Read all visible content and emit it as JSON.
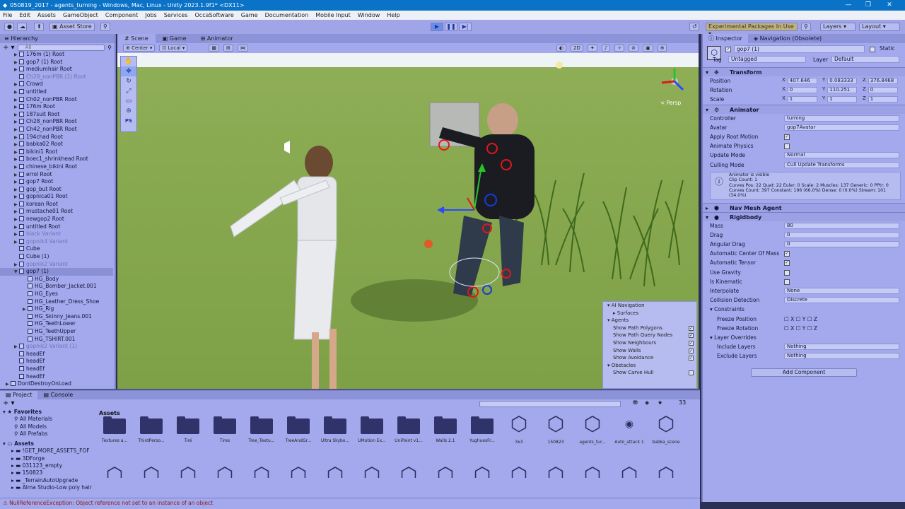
{
  "window": {
    "title": "050819_2017 - agents_turning - Windows, Mac, Linux - Unity 2023.1.9f1* <DX11>",
    "controls": [
      "—",
      "❐",
      "✕"
    ]
  },
  "menu": [
    "File",
    "Edit",
    "Assets",
    "GameObject",
    "Component",
    "Jobs",
    "Services",
    "OccaSoftware",
    "Game",
    "Documentation",
    "Mobile Input",
    "Window",
    "Help"
  ],
  "toolbar": {
    "asset_store": "Asset Store",
    "experimental": "Experimental Packages In Use",
    "layers": "Layers",
    "layout": "Layout"
  },
  "hierarchy": {
    "title": "Hierarchy",
    "search_placeholder": "All",
    "items": [
      {
        "label": "176m (1) Root",
        "indent": 1,
        "arrow": "▶",
        "dim": false
      },
      {
        "label": "gop7 (1) Root",
        "indent": 1,
        "arrow": "▶",
        "dim": false
      },
      {
        "label": "mediumhair Root",
        "indent": 1,
        "arrow": "▶",
        "dim": false
      },
      {
        "label": "Ch28_nonPBR (1) Root",
        "indent": 1,
        "arrow": "",
        "dim": true
      },
      {
        "label": "Crowd",
        "indent": 1,
        "arrow": "▶",
        "dim": false
      },
      {
        "label": "untitled",
        "indent": 1,
        "arrow": "▶",
        "dim": false
      },
      {
        "label": "Ch02_nonPBR Root",
        "indent": 1,
        "arrow": "▶",
        "dim": false
      },
      {
        "label": "176m Root",
        "indent": 1,
        "arrow": "▶",
        "dim": false
      },
      {
        "label": "187suit Root",
        "indent": 1,
        "arrow": "▶",
        "dim": false
      },
      {
        "label": "Ch28_nonPBR Root",
        "indent": 1,
        "arrow": "▶",
        "dim": false
      },
      {
        "label": "Ch42_nonPBR Root",
        "indent": 1,
        "arrow": "▶",
        "dim": false
      },
      {
        "label": "194chad Root",
        "indent": 1,
        "arrow": "▶",
        "dim": false
      },
      {
        "label": "babka02 Root",
        "indent": 1,
        "arrow": "▶",
        "dim": false
      },
      {
        "label": "bikini1 Root",
        "indent": 1,
        "arrow": "▶",
        "dim": false
      },
      {
        "label": "boec1_shrinkhead Root",
        "indent": 1,
        "arrow": "▶",
        "dim": false
      },
      {
        "label": "chinese_bikini Root",
        "indent": 1,
        "arrow": "▶",
        "dim": false
      },
      {
        "label": "errol Root",
        "indent": 1,
        "arrow": "▶",
        "dim": false
      },
      {
        "label": "gop7 Root",
        "indent": 1,
        "arrow": "▶",
        "dim": false
      },
      {
        "label": "gop_but Root",
        "indent": 1,
        "arrow": "▶",
        "dim": false
      },
      {
        "label": "gopnica01 Root",
        "indent": 1,
        "arrow": "▶",
        "dim": false
      },
      {
        "label": "korean Root",
        "indent": 1,
        "arrow": "▶",
        "dim": false
      },
      {
        "label": "mustache01 Root",
        "indent": 1,
        "arrow": "▶",
        "dim": false
      },
      {
        "label": "newgop2 Root",
        "indent": 1,
        "arrow": "▶",
        "dim": false
      },
      {
        "label": "untitled Root",
        "indent": 1,
        "arrow": "▶",
        "dim": false
      },
      {
        "label": "black Variant",
        "indent": 1,
        "arrow": "▶",
        "dim": true
      },
      {
        "label": "gopnik4 Variant",
        "indent": 1,
        "arrow": "▶",
        "dim": true
      },
      {
        "label": "Cube",
        "indent": 1,
        "arrow": "",
        "dim": false
      },
      {
        "label": "Cube (1)",
        "indent": 1,
        "arrow": "",
        "dim": false
      },
      {
        "label": "gopnik2 Variant",
        "indent": 1,
        "arrow": "▶",
        "dim": true
      },
      {
        "label": "gop7 (1)",
        "indent": 1,
        "arrow": "▼",
        "dim": false,
        "selected": true
      },
      {
        "label": "HG_Body",
        "indent": 2,
        "arrow": "",
        "dim": false
      },
      {
        "label": "HG_Bomber_Jacket.001",
        "indent": 2,
        "arrow": "",
        "dim": false
      },
      {
        "label": "HG_Eyes",
        "indent": 2,
        "arrow": "",
        "dim": false
      },
      {
        "label": "HG_Leather_Dress_Shoe",
        "indent": 2,
        "arrow": "",
        "dim": false
      },
      {
        "label": "HG_Rig",
        "indent": 2,
        "arrow": "▶",
        "dim": false
      },
      {
        "label": "HG_Skinny_Jeans.001",
        "indent": 2,
        "arrow": "",
        "dim": false
      },
      {
        "label": "HG_TeethLower",
        "indent": 2,
        "arrow": "",
        "dim": false
      },
      {
        "label": "HG_TeethUpper",
        "indent": 2,
        "arrow": "",
        "dim": false
      },
      {
        "label": "HG_TSHIRT.001",
        "indent": 2,
        "arrow": "",
        "dim": false
      },
      {
        "label": "gopnik2 Variant (1)",
        "indent": 1,
        "arrow": "▶",
        "dim": true
      },
      {
        "label": "headEf",
        "indent": 1,
        "arrow": "",
        "dim": false
      },
      {
        "label": "headEf",
        "indent": 1,
        "arrow": "",
        "dim": false
      },
      {
        "label": "headEf",
        "indent": 1,
        "arrow": "",
        "dim": false
      },
      {
        "label": "headEf",
        "indent": 1,
        "arrow": "",
        "dim": false
      },
      {
        "label": "DontDestroyOnLoad",
        "indent": 0,
        "arrow": "▶",
        "dim": false
      }
    ]
  },
  "scene": {
    "tabs": [
      "Scene",
      "Game",
      "Animator"
    ],
    "pivot": "Center",
    "space": "Local",
    "mode_2d": "2D",
    "persp_label": "< Persp",
    "ps_label": "PS"
  },
  "ai_navigation": {
    "title": "AI Navigation",
    "surfaces": "Surfaces",
    "agents": "Agents",
    "agent_options": [
      {
        "label": "Show Path Polygons",
        "checked": true
      },
      {
        "label": "Show Path Query Nodes",
        "checked": true
      },
      {
        "label": "Show Neighbours",
        "checked": true
      },
      {
        "label": "Show Walls",
        "checked": true
      },
      {
        "label": "Show Avoidance",
        "checked": true
      }
    ],
    "obstacles": "Obstacles",
    "obstacle_options": [
      {
        "label": "Show Carve Hull",
        "checked": false
      }
    ]
  },
  "inspector": {
    "tabs": [
      "Inspector",
      "Navigation (Obsolete)"
    ],
    "object_name": "gop7 (1)",
    "static_label": "Static",
    "tag_label": "Tag",
    "tag_value": "Untagged",
    "layer_label": "Layer",
    "layer_value": "Default",
    "transform": {
      "title": "Transform",
      "position": {
        "label": "Position",
        "x": "407.646",
        "y": "0.083333",
        "z": "376.8468"
      },
      "rotation": {
        "label": "Rotation",
        "x": "0",
        "y": "110.251",
        "z": "0"
      },
      "scale": {
        "label": "Scale",
        "x": "1",
        "y": "1",
        "z": "1"
      }
    },
    "animator": {
      "title": "Animator",
      "props": [
        {
          "label": "Controller",
          "value": "turning",
          "type": "field"
        },
        {
          "label": "Avatar",
          "value": "gop7Avatar",
          "type": "field"
        },
        {
          "label": "Apply Root Motion",
          "value": "✓",
          "type": "check"
        },
        {
          "label": "Animate Physics",
          "value": "",
          "type": "check"
        },
        {
          "label": "Update Mode",
          "value": "Normal",
          "type": "field"
        },
        {
          "label": "Culling Mode",
          "value": "Cull Update Transforms",
          "type": "field"
        }
      ],
      "info_lines": [
        "Animator is visible",
        "Clip Count: 1",
        "Curves Pos: 22 Quat: 22 Euler: 0 Scale: 2 Muscles: 137 Generic: 0 PPtr: 0",
        "Curves Count: 397 Constant: 196 (66.0%) Dense: 0 (0.0%) Stream: 101",
        "(34.0%)"
      ]
    },
    "nav_agent": {
      "title": "Nav Mesh Agent"
    },
    "rigidbody": {
      "title": "Rigidbody",
      "props": [
        {
          "label": "Mass",
          "value": "80",
          "type": "field"
        },
        {
          "label": "Drag",
          "value": "0",
          "type": "field"
        },
        {
          "label": "Angular Drag",
          "value": "0",
          "type": "field"
        },
        {
          "label": "Automatic Center Of Mass",
          "value": "✓",
          "type": "check"
        },
        {
          "label": "Automatic Tensor",
          "value": "✓",
          "type": "check"
        },
        {
          "label": "Use Gravity",
          "value": "",
          "type": "check"
        },
        {
          "label": "Is Kinematic",
          "value": "",
          "type": "check"
        },
        {
          "label": "Interpolate",
          "value": "None",
          "type": "field"
        },
        {
          "label": "Collision Detection",
          "value": "Discrete",
          "type": "field"
        }
      ],
      "constraints_label": "Constraints",
      "freeze_position": "Freeze Position",
      "freeze_rotation": "Freeze Rotation",
      "axes": [
        "X",
        "Y",
        "Z"
      ],
      "layer_overrides": "Layer Overrides",
      "include_layers": {
        "label": "Include Layers",
        "value": "Nothing"
      },
      "exclude_layers": {
        "label": "Exclude Layers",
        "value": "Nothing"
      }
    },
    "add_component": "Add Component"
  },
  "project": {
    "tabs": [
      "Project",
      "Console"
    ],
    "favorites": "Favorites",
    "favorite_items": [
      "All Materials",
      "All Models",
      "All Prefabs"
    ],
    "assets_root": "Assets",
    "asset_folders": [
      "!GET_MORE_ASSETS_FOF",
      "3DForge",
      "031123_empty",
      "150823",
      "_TerrainAutoUpgrade",
      "Alma Studio-Low poly hair"
    ],
    "breadcrumb": "Assets",
    "item_count": "33",
    "grid_row1": [
      {
        "label": "Textures a...",
        "kind": "folder"
      },
      {
        "label": "ThirdPerso...",
        "kind": "folder"
      },
      {
        "label": "Tiré",
        "kind": "folder"
      },
      {
        "label": "Tires",
        "kind": "folder"
      },
      {
        "label": "Tree_Textu...",
        "kind": "folder"
      },
      {
        "label": "TreeAndGr...",
        "kind": "folder"
      },
      {
        "label": "Ultra Skybo...",
        "kind": "folder"
      },
      {
        "label": "UMotion Ex...",
        "kind": "folder"
      },
      {
        "label": "UniPaint v1...",
        "kind": "folder"
      },
      {
        "label": "Walls 2.1",
        "kind": "folder"
      },
      {
        "label": "YughuesFr...",
        "kind": "folder"
      },
      {
        "label": "3x3",
        "kind": "unity"
      },
      {
        "label": "150823",
        "kind": "unity"
      },
      {
        "label": "agents_tur...",
        "kind": "unity"
      },
      {
        "label": "Auto_attack 1",
        "kind": "other"
      },
      {
        "label": "babka_scene",
        "kind": "unity"
      }
    ]
  },
  "status": {
    "message": "NullReferenceException: Object reference not set to an instance of an object"
  }
}
